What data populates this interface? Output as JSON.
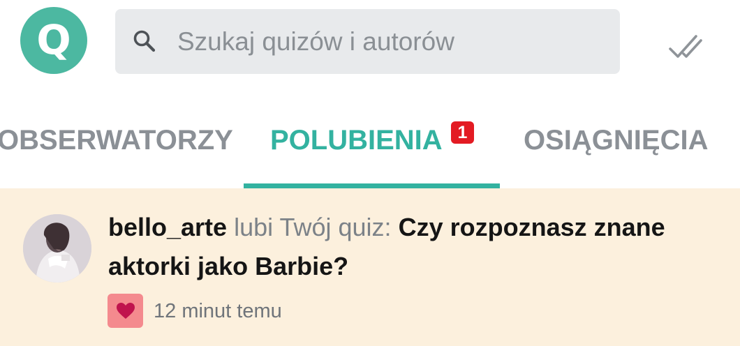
{
  "header": {
    "logo_letter": "Q",
    "search_placeholder": "Szukaj quizów i autorów",
    "icons": {
      "logo": "quiz-logo-icon",
      "search": "search-icon",
      "mark_read": "double-check-icon"
    }
  },
  "tabs": [
    {
      "label": "OBSERWATORZY",
      "active": false
    },
    {
      "label": "POLUBIENIA",
      "active": true,
      "badge": "1"
    },
    {
      "label": "OSIĄGNIĘCIA",
      "active": false
    }
  ],
  "notification": {
    "username": "bello_arte",
    "action": "lubi Twój quiz:",
    "quiz_title": "Czy rozpoznasz znane aktorki jako Barbie?",
    "time": "12 minut temu",
    "type_icon": "heart-icon"
  },
  "colors": {
    "accent": "#33b2a0",
    "logo": "#4cb8a1",
    "badge": "#e31b23",
    "notification_bg": "#fcf0dd",
    "heart_bg": "#f48a8e",
    "heart": "#c0134d"
  }
}
